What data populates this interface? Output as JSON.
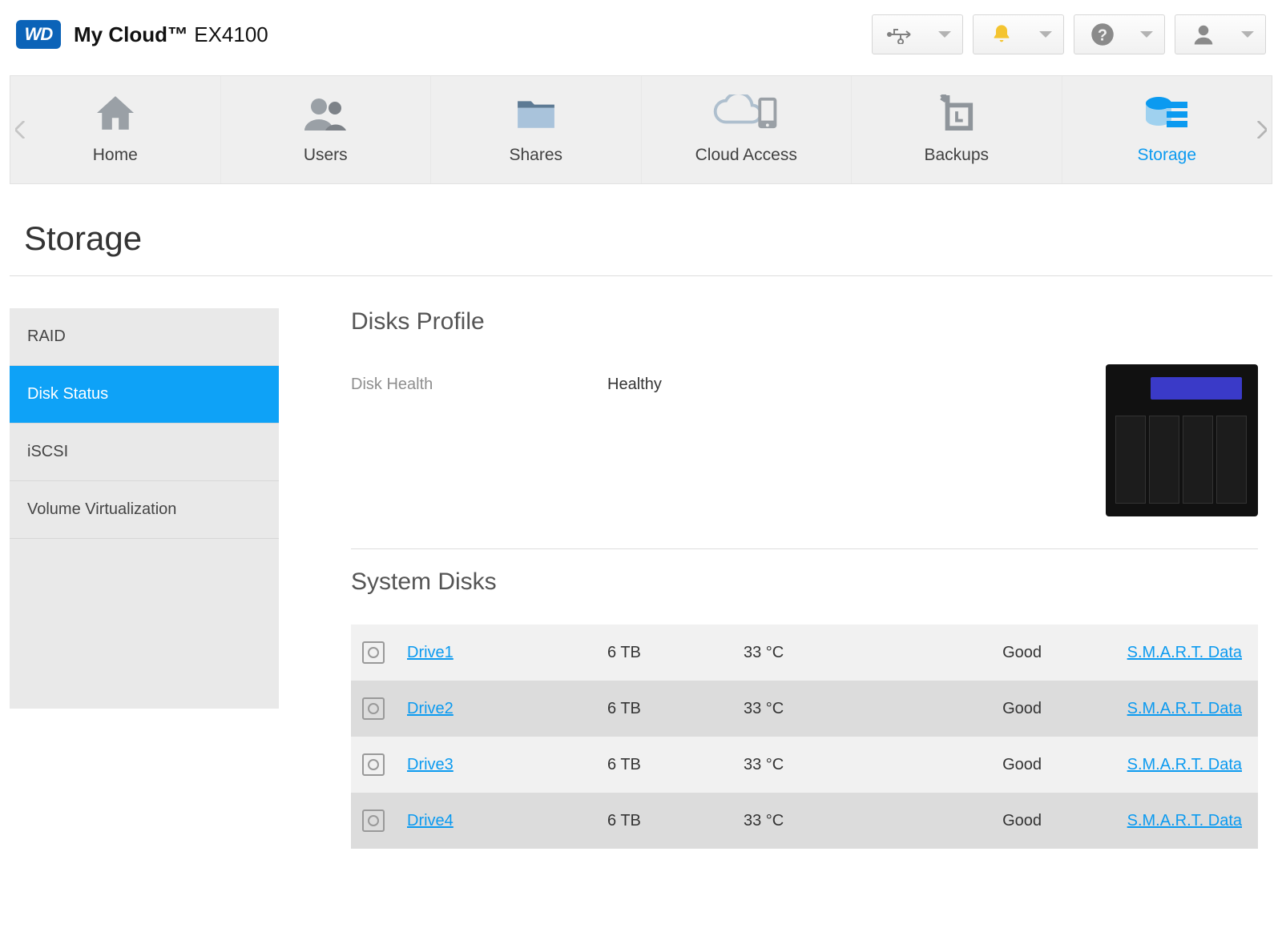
{
  "brand": {
    "logo_text": "WD",
    "product_strong": "My Cloud™",
    "product_rest": " EX4100"
  },
  "nav": {
    "items": [
      {
        "label": "Home"
      },
      {
        "label": "Users"
      },
      {
        "label": "Shares"
      },
      {
        "label": "Cloud Access"
      },
      {
        "label": "Backups"
      },
      {
        "label": "Storage"
      }
    ]
  },
  "page": {
    "title": "Storage"
  },
  "sidebar": {
    "items": [
      {
        "label": "RAID"
      },
      {
        "label": "Disk Status"
      },
      {
        "label": "iSCSI"
      },
      {
        "label": "Volume Virtualization"
      }
    ]
  },
  "profile": {
    "heading": "Disks Profile",
    "health_label": "Disk Health",
    "health_value": "Healthy"
  },
  "disks": {
    "heading": "System Disks",
    "smart_link": "S.M.A.R.T. Data",
    "rows": [
      {
        "name": "Drive1",
        "size": "6 TB",
        "temp": "33 °C",
        "status": "Good"
      },
      {
        "name": "Drive2",
        "size": "6 TB",
        "temp": "33 °C",
        "status": "Good"
      },
      {
        "name": "Drive3",
        "size": "6 TB",
        "temp": "33 °C",
        "status": "Good"
      },
      {
        "name": "Drive4",
        "size": "6 TB",
        "temp": "33 °C",
        "status": "Good"
      }
    ]
  }
}
